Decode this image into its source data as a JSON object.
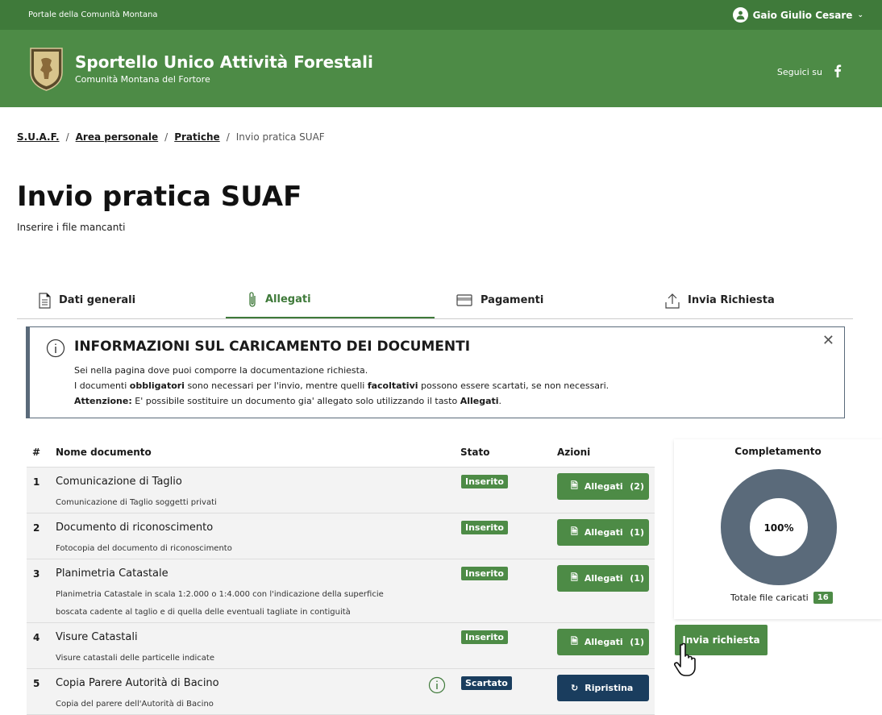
{
  "topbar": {
    "portal": "Portale della Comunità Montana",
    "user": "Gaio Giulio Cesare"
  },
  "header": {
    "title": "Sportello Unico Attività Forestali",
    "subtitle": "Comunità Montana del Fortore",
    "social_label": "Seguici su",
    "social_icon": "facebook-icon"
  },
  "breadcrumb": {
    "items": [
      "S.U.A.F.",
      "Area personale",
      "Pratiche"
    ],
    "current": "Invio pratica SUAF",
    "sep": "/"
  },
  "page": {
    "title": "Invio pratica SUAF",
    "lead": "Inserire i file mancanti"
  },
  "tabs": [
    {
      "label": "Dati generali",
      "icon": "document-icon"
    },
    {
      "label": "Allegati",
      "icon": "paperclip-icon",
      "active": true
    },
    {
      "label": "Pagamenti",
      "icon": "credit-card-icon"
    },
    {
      "label": "Invia Richiesta",
      "icon": "upload-icon"
    }
  ],
  "alert": {
    "title": "INFORMAZIONI SUL CARICAMENTO DEI DOCUMENTI",
    "line1": "Sei nella pagina dove puoi comporre la documentazione richiesta.",
    "line2_a": "I documenti ",
    "line2_b": "obbligatori",
    "line2_c": " sono necessari per l'invio, mentre quelli ",
    "line2_d": "facoltativi",
    "line2_e": " possono essere scartati, se non necessari.",
    "line3_a": "Attenzione:",
    "line3_b": " E' possibile sostituire un documento gia' allegato solo utilizzando il tasto ",
    "line3_c": "Allegati",
    "line3_d": "."
  },
  "table": {
    "headers": {
      "num": "#",
      "name": "Nome documento",
      "state": "Stato",
      "actions": "Azioni"
    },
    "rows": [
      {
        "num": "1",
        "name": "Comunicazione di Taglio",
        "desc": "Comunicazione di Taglio soggetti privati",
        "state": "Inserito",
        "action": "Allegati",
        "count": "(2)"
      },
      {
        "num": "2",
        "name": "Documento di riconoscimento",
        "desc": "Fotocopia del documento di riconoscimento",
        "state": "Inserito",
        "action": "Allegati",
        "count": "(1)"
      },
      {
        "num": "3",
        "name": "Planimetria Catastale",
        "desc": "Planimetria Catastale in scala 1:2.000 o 1:4.000 con l'indicazione della superficie boscata cadente al taglio e di quella delle eventuali tagliate in contiguità",
        "state": "Inserito",
        "action": "Allegati",
        "count": "(1)"
      },
      {
        "num": "4",
        "name": "Visure Catastali",
        "desc": "Visure catastali delle particelle indicate",
        "state": "Inserito",
        "action": "Allegati",
        "count": "(1)"
      },
      {
        "num": "5",
        "name": "Copia Parere Autorità di Bacino",
        "desc": "Copia del parere dell'Autorità di Bacino",
        "state": "Scartato",
        "action": "Ripristina",
        "count": ""
      }
    ]
  },
  "side": {
    "title": "Completamento",
    "percent": "100%",
    "progress": 1.0,
    "total_label": "Totale file caricati",
    "total": "16"
  },
  "send_button": "Invia richiesta",
  "colors": {
    "green": "#4d8b46",
    "navy": "#1a3d5e",
    "donut": "#5a6a7a"
  }
}
